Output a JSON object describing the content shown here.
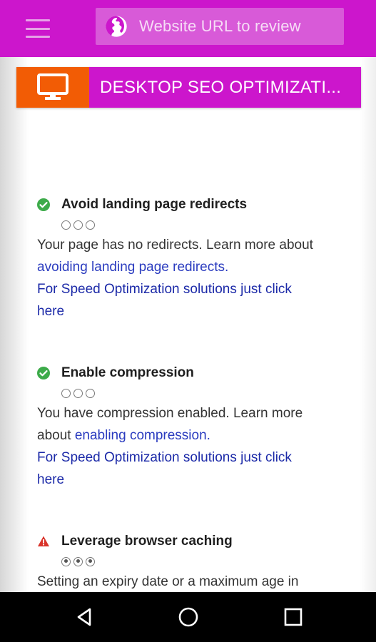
{
  "appbar": {
    "url_placeholder": "Website URL to review"
  },
  "banner": {
    "title": "DESKTOP SEO OPTIMIZATI..."
  },
  "items": [
    {
      "title": "Avoid landing page redirects",
      "status": "pass",
      "impact_dots_filled": 0,
      "description": "Your page has no redirects. Learn more about",
      "link": "avoiding landing page redirects.",
      "solution_line1": "For Speed Optimization solutions just click",
      "solution_line2": "here"
    },
    {
      "title": "Enable compression",
      "status": "pass",
      "impact_dots_filled": 0,
      "description_line1": "You have compression enabled. Learn more",
      "description_line2": "about",
      "link": "enabling compression.",
      "solution_line1": "For Speed Optimization solutions just click",
      "solution_line2": "here"
    },
    {
      "title": "Leverage browser caching",
      "status": "warning",
      "impact_dots_filled": 3,
      "description": "Setting an expiry date or a maximum age in"
    }
  ],
  "colors": {
    "appbar": "#cc16cc",
    "banner_icon_bg": "#f25c05",
    "pass": "#3dab4a",
    "warning": "#d9342b",
    "link": "#2a3bbf"
  },
  "icons": {
    "menu": "hamburger-icon",
    "url": "globe-icon",
    "banner": "desktop-monitor-icon",
    "pass": "check-circle-icon",
    "warning": "warning-triangle-icon",
    "nav_back": "back-triangle-icon",
    "nav_home": "home-circle-icon",
    "nav_recents": "recents-square-icon"
  }
}
